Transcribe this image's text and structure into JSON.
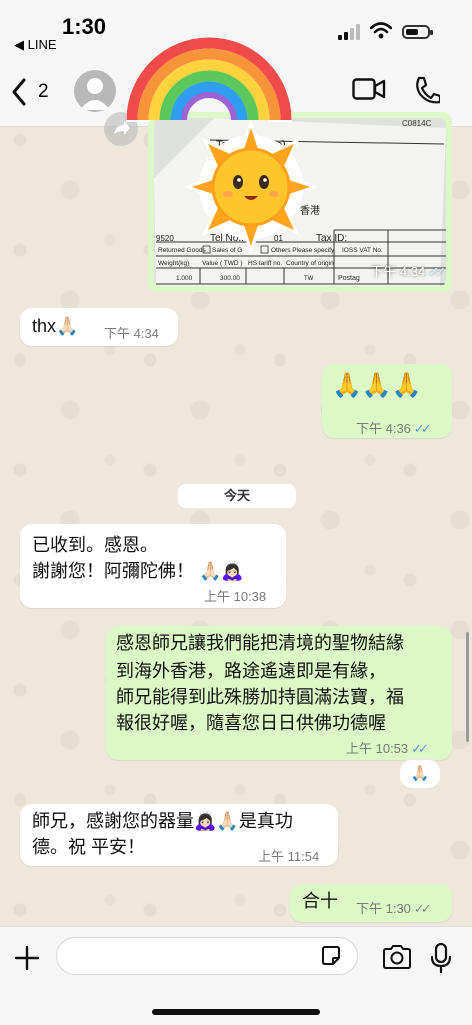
{
  "status_bar": {
    "time": "1:30",
    "back_app": "◀ LINE"
  },
  "header": {
    "back_count": "2"
  },
  "image_message": {
    "time": "下午 4:34",
    "doc_labels": {
      "to": "To(Ad",
      "address_suffix": "e)",
      "hk": "香港",
      "tel": "Tel No.:",
      "tax": "Tax ID:",
      "ioss": "IOSS VAT No.",
      "postage": "Postag",
      "code_left": "9520",
      "code_top": "C0814C",
      "returned": "Returned Goods",
      "sales": "Sales of G",
      "others": "Others Please specify",
      "weight": "Weight(kg)",
      "value": "Value ( TWD )",
      "hs": "HS tariff no.",
      "origin": "Country of origin",
      "weight_val": "1.000",
      "value_val": "300.00",
      "origin_val": "TW",
      "code_01": "01"
    }
  },
  "messages": [
    {
      "id": "m1",
      "dir": "in",
      "lines": [
        "thx🙏🏻"
      ],
      "time": "下午 4:34"
    },
    {
      "id": "m2",
      "dir": "out",
      "lines": [
        "🙏🙏🙏"
      ],
      "time": "下午 4:36",
      "ticks": "✓✓"
    },
    {
      "id": "m3",
      "dir": "in",
      "lines": [
        "已收到。感恩。",
        "謝謝您！阿彌陀佛！ 🙏🏻🙇🏻‍♀️"
      ],
      "time": "上午 10:38"
    },
    {
      "id": "m4",
      "dir": "out",
      "lines": [
        "感恩師兄讓我們能把清境的聖物結緣",
        "到海外香港，路途遙遠即是有緣，",
        "師兄能得到此殊勝加持圓滿法寶，福",
        "報很好喔，隨喜您日日供佛功德喔"
      ],
      "time": "上午 10:53",
      "ticks": "✓✓",
      "reaction": "🙏🏻"
    },
    {
      "id": "m5",
      "dir": "in",
      "lines": [
        "師兄，感謝您的器量🙇🏻‍♀️🙏🏻是真功",
        "德。祝 平安！"
      ],
      "time": "上午 11:54"
    },
    {
      "id": "m6",
      "dir": "out",
      "lines": [
        "合十"
      ],
      "time": "下午 1:30",
      "ticks": "✓✓"
    }
  ],
  "day_separator": "今天",
  "colors": {
    "incoming": "#ffffff",
    "outgoing": "#dcf8c6",
    "read_tick": "#4fa3e0",
    "background": "#efe7dc"
  }
}
